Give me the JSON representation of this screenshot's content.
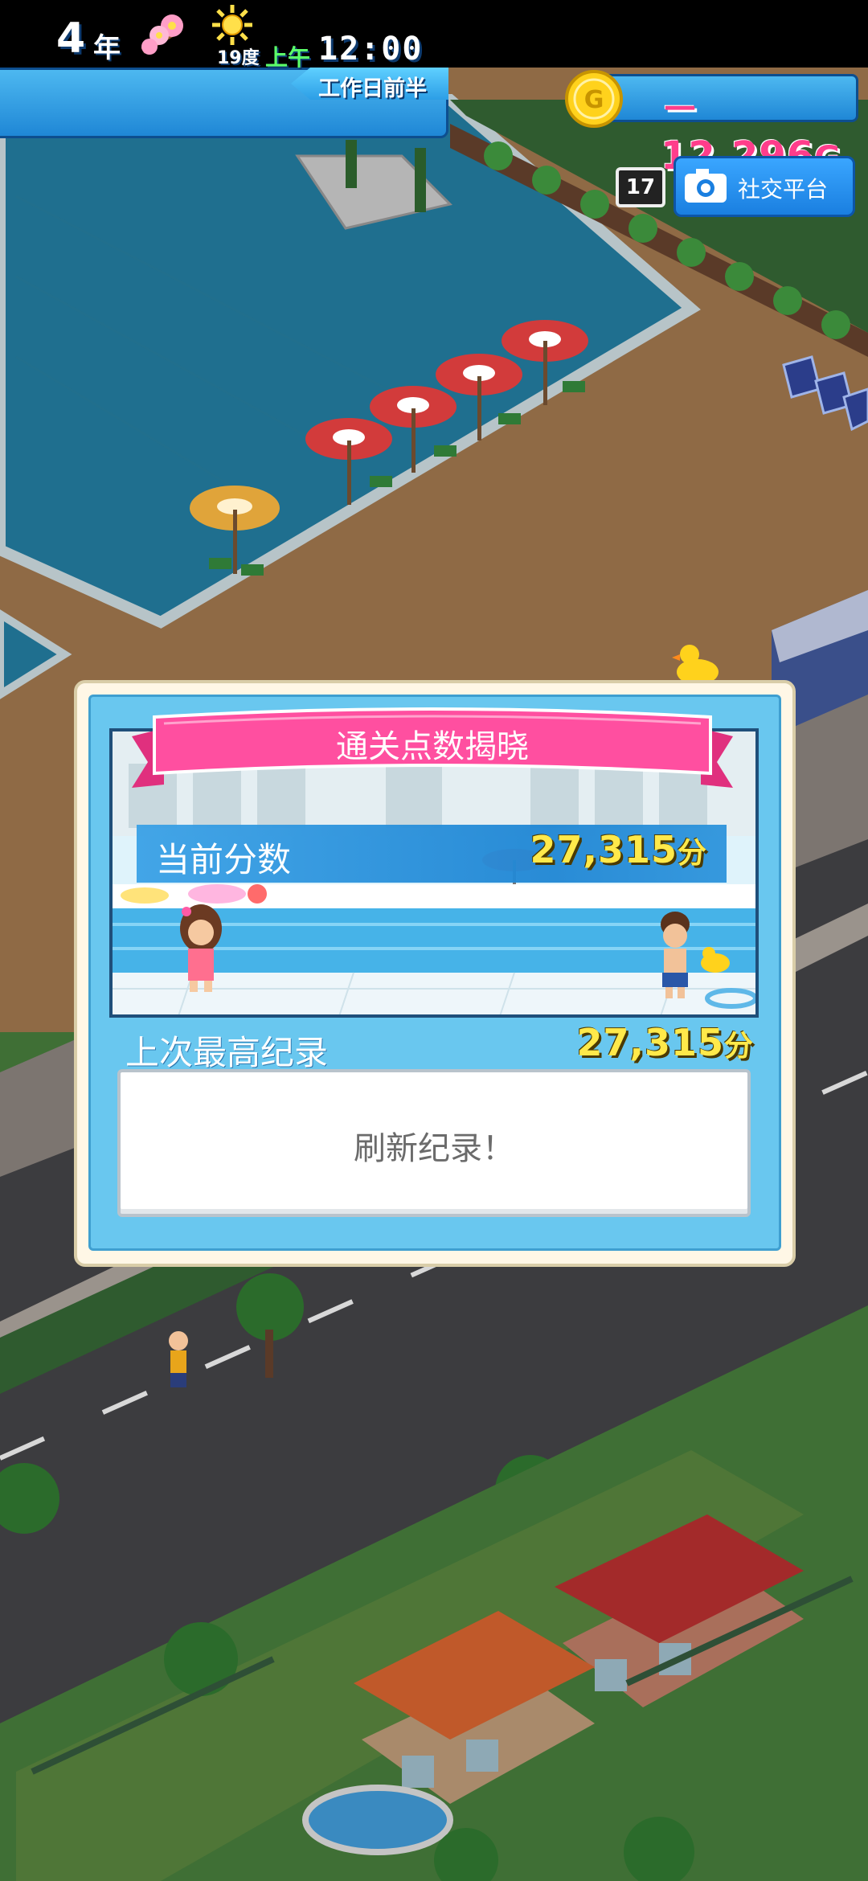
{
  "hud": {
    "year_number": "4",
    "year_unit": "年",
    "period": "工作日前半",
    "temperature": "19度",
    "ampm": "上午",
    "clock": "12:00",
    "money": "－12,296",
    "money_unit": "G",
    "social_count": "17",
    "social_label": "社交平台"
  },
  "dialog": {
    "title": "通关点数揭晓",
    "current_label": "当前分数",
    "current_value": "27,315",
    "best_label": "上次最高纪录",
    "best_value": "27,315",
    "score_unit": "分",
    "record_message": "刷新纪录！"
  },
  "colors": {
    "hud_blue": "#1f87d6",
    "money_pink": "#ff3d8b",
    "score_yellow": "#ffe94a",
    "ribbon_pink": "#ff4fa0",
    "dialog_blue": "#69c7ef"
  }
}
